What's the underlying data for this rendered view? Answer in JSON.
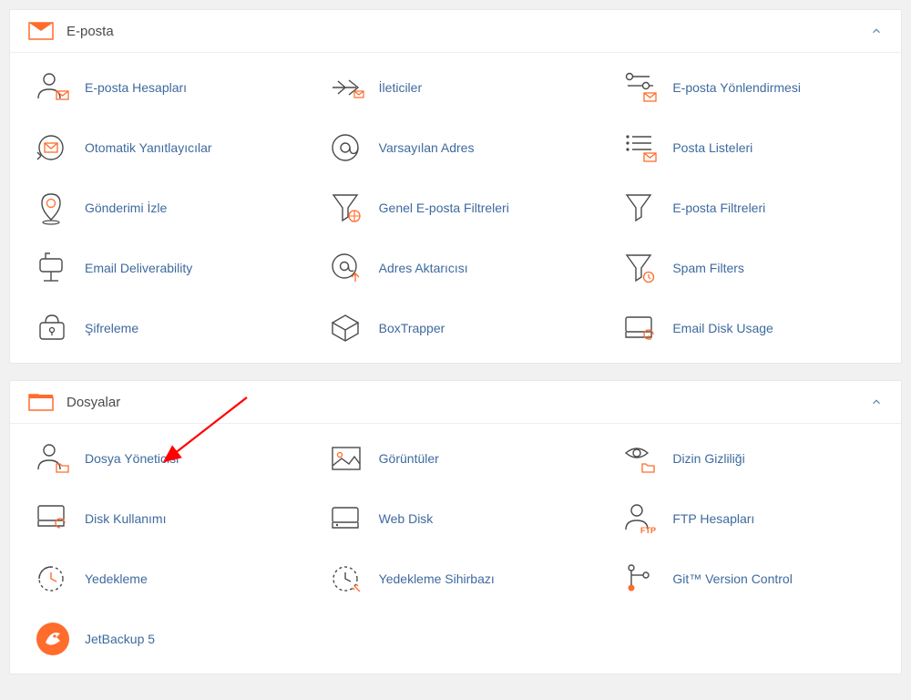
{
  "sections": {
    "email": {
      "title": "E-posta",
      "items": {
        "email_accounts": "E-posta Hesapları",
        "forwarders": "İleticiler",
        "email_routing": "E-posta Yönlendirmesi",
        "autoresponders": "Otomatik Yanıtlayıcılar",
        "default_address": "Varsayılan Adres",
        "mailing_lists": "Posta Listeleri",
        "track_delivery": "Gönderimi İzle",
        "global_email_filters": "Genel E-posta Filtreleri",
        "email_filters": "E-posta Filtreleri",
        "email_deliverability": "Email Deliverability",
        "address_importer": "Adres Aktarıcısı",
        "spam_filters": "Spam Filters",
        "encryption": "Şifreleme",
        "boxtrapper": "BoxTrapper",
        "email_disk_usage": "Email Disk Usage"
      }
    },
    "files": {
      "title": "Dosyalar",
      "items": {
        "file_manager": "Dosya Yöneticisi",
        "images": "Görüntüler",
        "directory_privacy": "Dizin Gizliliği",
        "disk_usage": "Disk Kullanımı",
        "web_disk": "Web Disk",
        "ftp_accounts": "FTP Hesapları",
        "backup": "Yedekleme",
        "backup_wizard": "Yedekleme Sihirbazı",
        "git": "Git™ Version Control",
        "jetbackup": "JetBackup 5"
      }
    }
  }
}
